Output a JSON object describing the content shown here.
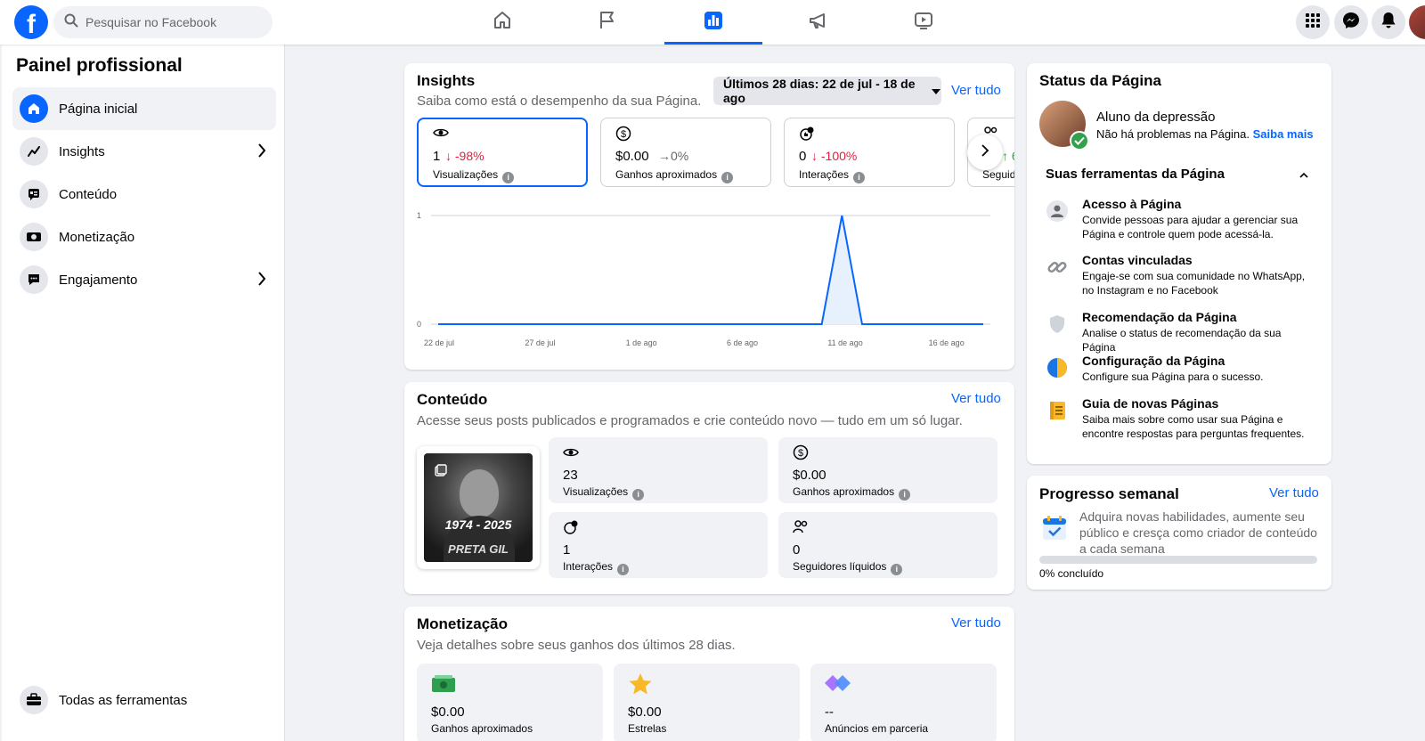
{
  "topbar": {
    "search_placeholder": "Pesquisar no Facebook",
    "nav_tabs": [
      "home-icon",
      "flag-icon",
      "chart-icon",
      "megaphone-icon",
      "video-icon"
    ],
    "active_tab": "chart-icon"
  },
  "sidebar": {
    "title": "Painel profissional",
    "items": [
      {
        "label": "Página inicial",
        "icon": "home-icon"
      },
      {
        "label": "Insights",
        "icon": "insights-icon"
      },
      {
        "label": "Conteúdo",
        "icon": "content-icon"
      },
      {
        "label": "Monetização",
        "icon": "money-icon"
      },
      {
        "label": "Engajamento",
        "icon": "chat-icon"
      }
    ],
    "all_tools": "Todas as ferramentas"
  },
  "insights": {
    "title": "Insights",
    "subtitle": "Saiba como está o desempenho da sua Página.",
    "date_range": "Últimos 28 dias: 22 de jul - 18 de ago",
    "see_all": "Ver tudo",
    "metrics": [
      {
        "value": "1",
        "delta": "↓ -98%",
        "label": "Visualizações"
      },
      {
        "value": "$0.00",
        "delta": "→0%",
        "label": "Ganhos aproximados"
      },
      {
        "value": "0",
        "delta": "↓ -100%",
        "label": "Interações"
      },
      {
        "value": "",
        "delta": "↑ 6",
        "label": "Seguid"
      }
    ]
  },
  "chart_data": {
    "type": "area",
    "x": [
      "22 de jul",
      "23 de jul",
      "24 de jul",
      "25 de jul",
      "26 de jul",
      "27 de jul",
      "28 de jul",
      "29 de jul",
      "30 de jul",
      "31 de jul",
      "1 de ago",
      "2 de ago",
      "3 de ago",
      "4 de ago",
      "5 de ago",
      "6 de ago",
      "7 de ago",
      "8 de ago",
      "9 de ago",
      "10 de ago",
      "11 de ago",
      "12 de ago",
      "13 de ago",
      "14 de ago",
      "15 de ago",
      "16 de ago",
      "17 de ago",
      "18 de ago"
    ],
    "values": [
      0,
      0,
      0,
      0,
      0,
      0,
      0,
      0,
      0,
      0,
      0,
      0,
      0,
      0,
      0,
      0,
      0,
      0,
      0,
      0,
      1,
      0,
      0,
      0,
      0,
      0,
      0,
      0
    ],
    "x_tick_labels": [
      "22 de jul",
      "27 de jul",
      "1 de ago",
      "6 de ago",
      "11 de ago",
      "16 de ago"
    ],
    "y_tick_labels": [
      "0",
      "1"
    ],
    "ylim": [
      0,
      1
    ],
    "grid": true,
    "color": "#0866ff"
  },
  "content": {
    "title": "Conteúdo",
    "subtitle": "Acesse seus posts publicados e programados e crie conteúdo novo — tudo em um só lugar.",
    "see_all": "Ver tudo",
    "thumb_years": "1974 - 2025",
    "thumb_name": "PRETA GIL",
    "stats": [
      {
        "value": "23",
        "label": "Visualizações"
      },
      {
        "value": "$0.00",
        "label": "Ganhos aproximados"
      },
      {
        "value": "1",
        "label": "Interações"
      },
      {
        "value": "0",
        "label": "Seguidores líquidos"
      }
    ]
  },
  "monetization": {
    "title": "Monetização",
    "subtitle": "Veja detalhes sobre seus ganhos dos últimos 28 dias.",
    "see_all": "Ver tudo",
    "boxes": [
      {
        "value": "$0.00",
        "label": "Ganhos aproximados"
      },
      {
        "value": "$0.00",
        "label": "Estrelas"
      },
      {
        "value": "--",
        "label": "Anúncios em parceria"
      }
    ]
  },
  "page_status": {
    "title": "Status da Página",
    "page_name": "Aluno da depressão",
    "status_text": "Não há problemas na Página.",
    "learn_more": "Saiba mais",
    "tools_heading": "Suas ferramentas da Página",
    "tools": [
      {
        "name": "Acesso à Página",
        "desc": "Convide pessoas para ajudar a gerenciar sua Página e controle quem pode acessá-la."
      },
      {
        "name": "Contas vinculadas",
        "desc": "Engaje-se com sua comunidade no WhatsApp, no Instagram e no Facebook"
      },
      {
        "name": "Recomendação da Página",
        "desc": "Analise o status de recomendação da sua Página"
      },
      {
        "name": "Configuração da Página",
        "desc": "Configure sua Página para o sucesso."
      },
      {
        "name": "Guia de novas Páginas",
        "desc": "Saiba mais sobre como usar sua Página e encontre respostas para perguntas frequentes."
      }
    ]
  },
  "weekly": {
    "title": "Progresso semanal",
    "see_all": "Ver tudo",
    "desc": "Adquira novas habilidades, aumente seu público e cresça como criador de conteúdo a cada semana",
    "progress_label": "0% concluído",
    "progress": 0
  }
}
